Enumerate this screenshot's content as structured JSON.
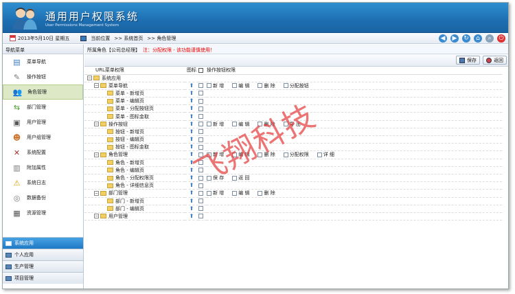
{
  "header": {
    "title_cn": "通用用户权限系统",
    "title_en": "User Permissions Management System"
  },
  "topbar": {
    "date": "2013年5月10日 星期五",
    "location_label": "当前位置",
    "crumb1": ">> 系统首页",
    "crumb2": ">> 角色管理"
  },
  "sidebar": {
    "title": "导航菜单",
    "items": [
      {
        "label": "菜单导航",
        "icon": "menu-nav-icon"
      },
      {
        "label": "操作按钮",
        "icon": "wrench-icon"
      },
      {
        "label": "角色管理",
        "icon": "role-icon",
        "active": true
      },
      {
        "label": "部门管理",
        "icon": "dept-icon"
      },
      {
        "label": "用户管理",
        "icon": "user-icon"
      },
      {
        "label": "用户组管理",
        "icon": "user-group-icon"
      },
      {
        "label": "系统配置",
        "icon": "tools-icon"
      },
      {
        "label": "附加属性",
        "icon": "attr-icon"
      },
      {
        "label": "系统日志",
        "icon": "log-icon"
      },
      {
        "label": "数据备份",
        "icon": "backup-icon"
      },
      {
        "label": "资源管理",
        "icon": "resource-icon"
      }
    ],
    "groups": [
      {
        "label": "系统应用",
        "selected": true
      },
      {
        "label": "个人应用"
      },
      {
        "label": "生产管理"
      },
      {
        "label": "项目管理"
      }
    ]
  },
  "main": {
    "role_label": "所属角色【公司总经理】",
    "warning": "注：分配权限 - 该功能谨慎使用！",
    "save": "保存",
    "back": "返回",
    "columns": {
      "url": "URL菜单权限",
      "icon": "图标",
      "ops": "操作按钮权限"
    },
    "rows": [
      {
        "level": 0,
        "exp": "−",
        "label": "系统应用",
        "ops": []
      },
      {
        "level": 1,
        "exp": "−",
        "label": "菜单导航",
        "ops": [
          "新 增",
          "编 辑",
          "删 除",
          "分配按钮"
        ]
      },
      {
        "level": 2,
        "label": "菜单 - 新增页",
        "ops": []
      },
      {
        "level": 2,
        "label": "菜单 - 编辑页",
        "ops": []
      },
      {
        "level": 2,
        "label": "菜单 - 分配按钮页",
        "ops": []
      },
      {
        "level": 2,
        "label": "菜单 - 图标金取",
        "ops": []
      },
      {
        "level": 1,
        "exp": "−",
        "label": "操作按钮",
        "ops": [
          "新 增",
          "编 辑",
          "删 除",
          "导 出"
        ]
      },
      {
        "level": 2,
        "label": "按钮 - 新增页",
        "ops": []
      },
      {
        "level": 2,
        "label": "按钮 - 编辑页",
        "ops": []
      },
      {
        "level": 2,
        "label": "按钮 - 图标金取",
        "ops": []
      },
      {
        "level": 1,
        "exp": "−",
        "label": "角色管理",
        "ops": [
          "新 增",
          "编 辑",
          "删 除",
          "分配权限",
          "详 细"
        ]
      },
      {
        "level": 2,
        "label": "角色 - 新增页",
        "ops": []
      },
      {
        "level": 2,
        "label": "角色 - 编辑页",
        "ops": []
      },
      {
        "level": 2,
        "label": "角色 - 分配权限页",
        "ops": [
          "保 存",
          "返 回"
        ]
      },
      {
        "level": 2,
        "label": "角色 - 详细信息页",
        "ops": []
      },
      {
        "level": 1,
        "exp": "−",
        "label": "部门管理",
        "ops": [
          "新 增",
          "编 辑",
          "删 除"
        ]
      },
      {
        "level": 2,
        "label": "部门 - 新增页",
        "ops": []
      },
      {
        "level": 2,
        "label": "部门 - 编辑页",
        "ops": []
      },
      {
        "level": 1,
        "exp": "−",
        "label": "用户管理",
        "ops": []
      }
    ]
  },
  "watermark": "飞翔科技"
}
